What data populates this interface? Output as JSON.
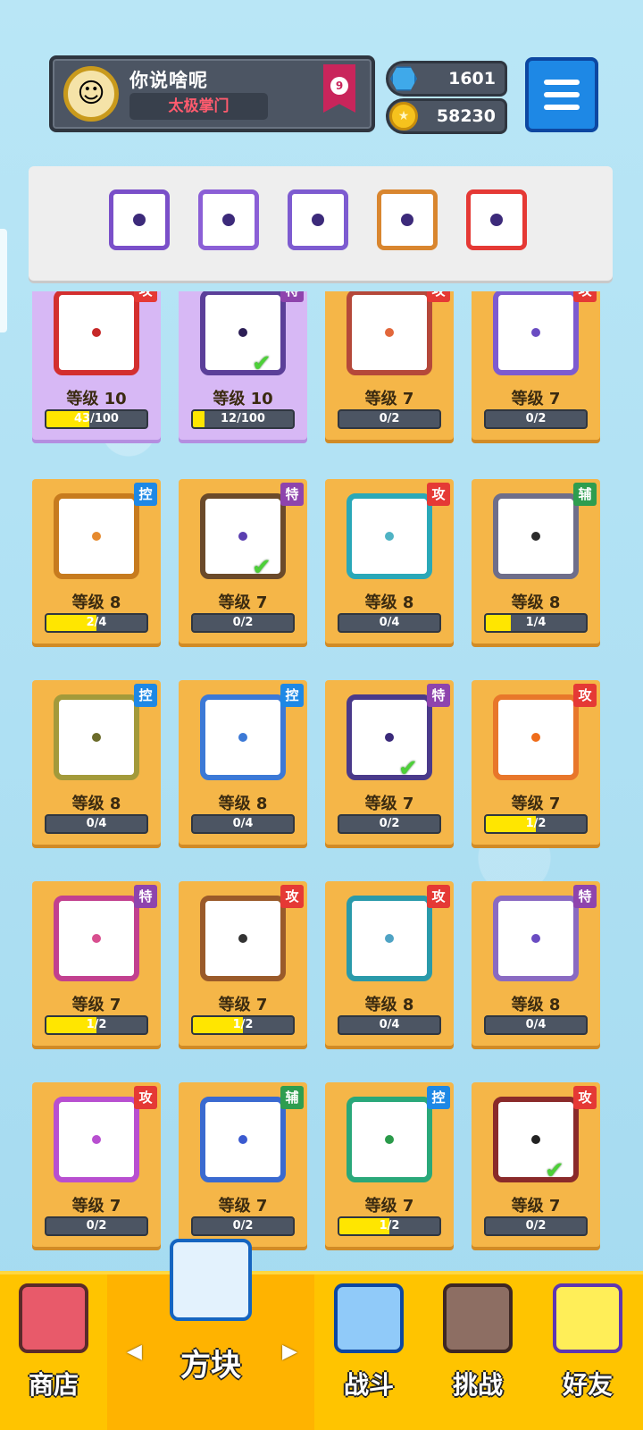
{
  "player": {
    "name": "你说啥呢",
    "title": "太极掌门",
    "rank": "9"
  },
  "currency": {
    "gems": "1601",
    "coins": "58230"
  },
  "colors": {
    "attack": "#e53935",
    "control": "#1e88e5",
    "special": "#8e44ad",
    "support": "#2e9d4f"
  },
  "deck": [
    {
      "icon": "saw-blade-icon",
      "border": "#7a4fc9"
    },
    {
      "icon": "shatter-icon",
      "border": "#8b5fd6"
    },
    {
      "icon": "target-icon",
      "border": "#7d5bd0"
    },
    {
      "icon": "infinity-icon",
      "border": "#d9862f"
    },
    {
      "icon": "rainbow-icon",
      "border": "#e53935"
    }
  ],
  "cards": [
    {
      "level": "等级 10",
      "progress": "43/100",
      "fill": 0.43,
      "tag": "攻",
      "tagColor": "attack",
      "icon": "fire-icon",
      "border": "#d32f2f",
      "dot": "#c62828",
      "purple": true,
      "check": false
    },
    {
      "level": "等级 10",
      "progress": "12/100",
      "fill": 0.12,
      "tag": "特",
      "tagColor": "special",
      "icon": "crack-icon",
      "border": "#5b3f99",
      "dot": "#2c1e55",
      "purple": true,
      "check": true
    },
    {
      "level": "等级 7",
      "progress": "0/2",
      "fill": 0,
      "tag": "攻",
      "tagColor": "attack",
      "icon": "spike-star-icon",
      "border": "#b5483a",
      "dot": "#e2673b",
      "purple": false,
      "check": false
    },
    {
      "level": "等级 7",
      "progress": "0/2",
      "fill": 0,
      "tag": "攻",
      "tagColor": "attack",
      "icon": "swirl-icon",
      "border": "#7d5bd0",
      "dot": "#6a4cc2",
      "purple": false,
      "check": false
    },
    {
      "level": "等级 8",
      "progress": "2/4",
      "fill": 0.5,
      "tag": "控",
      "tagColor": "control",
      "icon": "sand-icon",
      "border": "#c77b1e",
      "dot": "#e68a2e",
      "purple": false,
      "check": false
    },
    {
      "level": "等级 7",
      "progress": "0/2",
      "fill": 0,
      "tag": "特",
      "tagColor": "special",
      "icon": "infinity-icon",
      "border": "#6b4a2a",
      "dot": "#5b3fb0",
      "purple": false,
      "check": true
    },
    {
      "level": "等级 8",
      "progress": "0/4",
      "fill": 0,
      "tag": "攻",
      "tagColor": "attack",
      "icon": "ice-shard-icon",
      "border": "#2aa8b8",
      "dot": "#4fb3c4",
      "purple": false,
      "check": false
    },
    {
      "level": "等级 8",
      "progress": "1/4",
      "fill": 0.25,
      "tag": "辅",
      "tagColor": "support",
      "icon": "jaw-icon",
      "border": "#6e6e8a",
      "dot": "#2b2b2b",
      "purple": false,
      "check": false
    },
    {
      "level": "等级 8",
      "progress": "0/4",
      "fill": 0,
      "tag": "控",
      "tagColor": "control",
      "icon": "shield-ring-icon",
      "border": "#a39a3a",
      "dot": "#6b6b2a",
      "purple": false,
      "check": false
    },
    {
      "level": "等级 8",
      "progress": "0/4",
      "fill": 0,
      "tag": "控",
      "tagColor": "control",
      "icon": "snowflake-icon",
      "border": "#3c79d6",
      "dot": "#3c79d6",
      "purple": false,
      "check": false
    },
    {
      "level": "等级 7",
      "progress": "0/2",
      "fill": 0,
      "tag": "特",
      "tagColor": "special",
      "icon": "vortex-icon",
      "border": "#4a3a8a",
      "dot": "#3a2a7a",
      "purple": false,
      "check": true
    },
    {
      "level": "等级 7",
      "progress": "1/2",
      "fill": 0.5,
      "tag": "攻",
      "tagColor": "attack",
      "icon": "flame-wheel-icon",
      "border": "#e8772a",
      "dot": "#ef6c1a",
      "purple": false,
      "check": false
    },
    {
      "level": "等级 7",
      "progress": "1/2",
      "fill": 0.5,
      "tag": "特",
      "tagColor": "special",
      "icon": "cross-sword-icon",
      "border": "#c2408f",
      "dot": "#d84f8f",
      "purple": false,
      "check": false
    },
    {
      "level": "等级 7",
      "progress": "1/2",
      "fill": 0.5,
      "tag": "攻",
      "tagColor": "attack",
      "icon": "pistol-icon",
      "border": "#9a5a2a",
      "dot": "#333333",
      "purple": false,
      "check": false
    },
    {
      "level": "等级 8",
      "progress": "0/4",
      "fill": 0,
      "tag": "攻",
      "tagColor": "attack",
      "icon": "whirlpool-icon",
      "border": "#2a9aaa",
      "dot": "#4fa3c4",
      "purple": false,
      "check": false
    },
    {
      "level": "等级 8",
      "progress": "0/4",
      "fill": 0,
      "tag": "特",
      "tagColor": "special",
      "icon": "smoke-icon",
      "border": "#8a6ac2",
      "dot": "#6a4cc2",
      "purple": false,
      "check": false
    },
    {
      "level": "等级 7",
      "progress": "0/2",
      "fill": 0,
      "tag": "攻",
      "tagColor": "attack",
      "icon": "combo-icon",
      "border": "#b84fd0",
      "dot": "#b84fd0",
      "purple": false,
      "check": false
    },
    {
      "level": "等级 7",
      "progress": "0/2",
      "fill": 0,
      "tag": "辅",
      "tagColor": "support",
      "icon": "moon-icon",
      "border": "#3a6ad0",
      "dot": "#3a5ad0",
      "purple": false,
      "check": false
    },
    {
      "level": "等级 7",
      "progress": "1/2",
      "fill": 0.5,
      "tag": "控",
      "tagColor": "control",
      "icon": "wind-icon",
      "border": "#2aa87a",
      "dot": "#2a9a4a",
      "purple": false,
      "check": false
    },
    {
      "level": "等级 7",
      "progress": "0/2",
      "fill": 0,
      "tag": "攻",
      "tagColor": "attack",
      "icon": "black-saw-icon",
      "border": "#8a2a2a",
      "dot": "#222222",
      "purple": false,
      "check": true
    }
  ],
  "nav": {
    "shop": "商店",
    "blocks": "方块",
    "battle": "战斗",
    "challenge": "挑战",
    "friends": "好友"
  }
}
